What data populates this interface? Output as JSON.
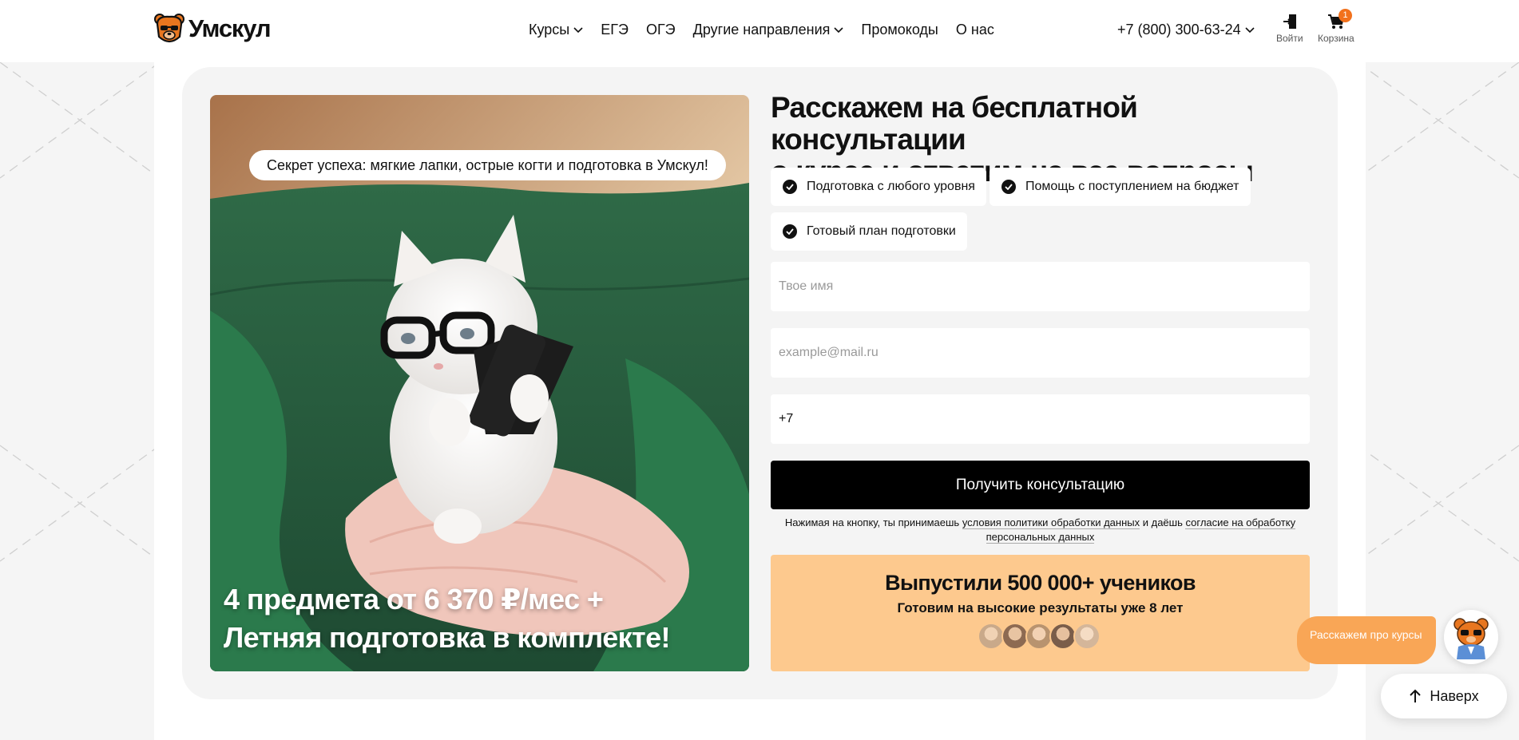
{
  "header": {
    "logo_text": "Умскул",
    "nav": [
      {
        "label": "Курсы",
        "dropdown": true
      },
      {
        "label": "ЕГЭ",
        "dropdown": false
      },
      {
        "label": "ОГЭ",
        "dropdown": false
      },
      {
        "label": "Другие направления",
        "dropdown": true
      },
      {
        "label": "Промокоды",
        "dropdown": false
      },
      {
        "label": "О нас",
        "dropdown": false
      }
    ],
    "phone": "+7 (800) 300-63-24",
    "login_label": "Войти",
    "cart_label": "Корзина",
    "cart_count": "1"
  },
  "promo_image": {
    "caption": "Секрет успеха: мягкие лапки, острые когти и подготовка в Умскул!",
    "promo_line1": "4 предмета от 6 370 ₽/мес +",
    "promo_line2": "Летняя подготовка в комплекте!"
  },
  "consult": {
    "headline_line1": "Расскажем на бесплатной консультации",
    "headline_line2": "о курсе и ответим на все вопросы",
    "features": [
      "Подготовка с любого уровня",
      "Помощь с поступлением на бюджет",
      "Готовый план подготовки"
    ],
    "name_placeholder": "Твое имя",
    "email_placeholder": "example@mail.ru",
    "phone_value": "+7",
    "submit_label": "Получить консультацию",
    "consent_prefix": "Нажимая на кнопку, ты принимаешь ",
    "consent_link1": "условия политики обработки данных",
    "consent_middle": " и даёшь ",
    "consent_link2a": "согласие на обработку",
    "consent_link2b": "персональных данных"
  },
  "stats": {
    "title": "Выпустили 500 000+ учеников",
    "subtitle": "Готовим на высокие результаты уже 8 лет",
    "avatar_colors": [
      "#c9a98a",
      "#8d6a52",
      "#b8936f",
      "#7a5d4a",
      "#d4b69a"
    ]
  },
  "widgets": {
    "chat_text": "Расскажем про курсы",
    "to_top_label": "Наверх"
  },
  "colors": {
    "accent_orange": "#f2711c",
    "stats_bg": "#fdc98e",
    "chat_bg": "#f9a656",
    "button_bg": "#000000"
  }
}
